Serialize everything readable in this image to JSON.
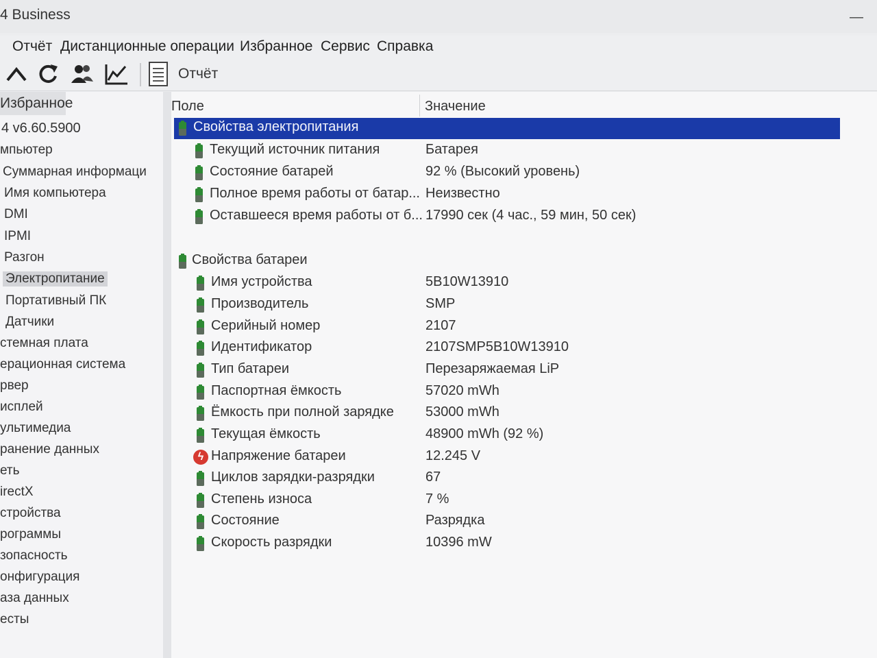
{
  "window": {
    "title": "4 Business",
    "minimize_glyph": "—"
  },
  "menu": [
    "Отчёт",
    "Дистанционные операции",
    "Избранное",
    "Сервис",
    "Справка"
  ],
  "toolbar": {
    "icons": [
      "up-icon",
      "refresh-icon",
      "users-icon",
      "chart-icon",
      "report-icon"
    ],
    "report_label": "Отчёт"
  },
  "left": {
    "header": "Избранное",
    "items": [
      "4 v6.60.5900",
      "мпьютер",
      "Суммарная информаци",
      "Имя компьютера",
      "DMI",
      "IPMI",
      "Разгон",
      "Электропитание",
      "Портативный ПК",
      "Датчики",
      "стемная плата",
      "ерационная система",
      "рвер",
      "исплей",
      "ультимедиа",
      "ранение данных",
      "еть",
      "irectX",
      "стройства",
      "рограммы",
      "зопасность",
      "онфигурация",
      "аза данных",
      "есты"
    ],
    "selected": "Электропитание"
  },
  "table": {
    "col_field": "Поле",
    "col_value": "Значение",
    "groups": [
      {
        "title": "Свойства электропитания",
        "rows": [
          {
            "field": "Текущий источник питания",
            "value": "Батарея"
          },
          {
            "field": "Состояние батарей",
            "value": "92 % (Высокий уровень)"
          },
          {
            "field": "Полное время работы от батар...",
            "value": "Неизвестно"
          },
          {
            "field": "Оставшееся время работы от б...",
            "value": "17990 сек (4 час., 59 мин, 50 сек)"
          }
        ]
      },
      {
        "title": "Свойства батареи",
        "rows": [
          {
            "field": "Имя устройства",
            "value": "5B10W13910"
          },
          {
            "field": "Производитель",
            "value": "SMP"
          },
          {
            "field": "Серийный номер",
            "value": "2107"
          },
          {
            "field": "Идентификатор",
            "value": "2107SMP5B10W13910"
          },
          {
            "field": "Тип батареи",
            "value": "Перезаряжаемая LiP"
          },
          {
            "field": "Паспортная ёмкость",
            "value": "57020 mWh"
          },
          {
            "field": "Ёмкость при полной зарядке",
            "value": "53000 mWh"
          },
          {
            "field": "Текущая ёмкость",
            "value": "48900 mWh  (92 %)"
          },
          {
            "field": "Напряжение батареи",
            "value": "12.245 V",
            "icon": "voltage-icon"
          },
          {
            "field": "Циклов зарядки-разрядки",
            "value": "67"
          },
          {
            "field": "Степень износа",
            "value": "7 %"
          },
          {
            "field": "Состояние",
            "value": "Разрядка"
          },
          {
            "field": "Скорость разрядки",
            "value": "10396 mW"
          }
        ]
      }
    ]
  },
  "colors": {
    "selection": "#1a3aa8",
    "battery_icon": "#2e8a34",
    "voltage_icon": "#d63a31"
  }
}
